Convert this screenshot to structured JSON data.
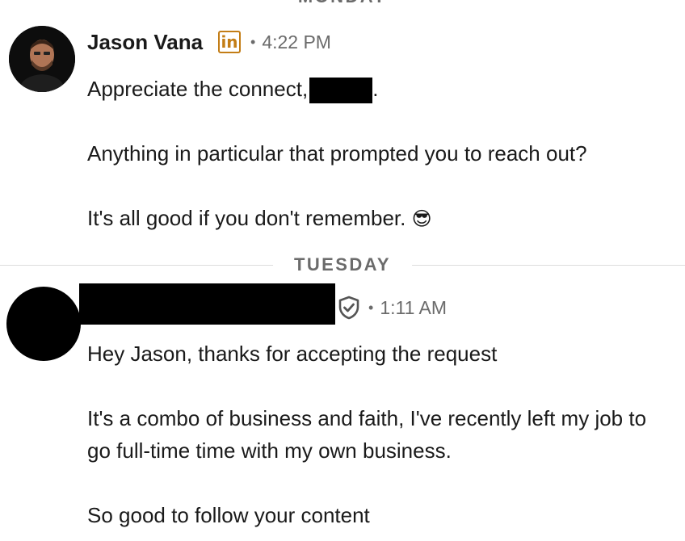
{
  "dividers": {
    "top": "MONDAY",
    "middle": "TUESDAY"
  },
  "messages": [
    {
      "sender": "Jason Vana",
      "badge": "in",
      "time": "4:22 PM",
      "lines": [
        "Appreciate the connect,",
        "Anything in particular that prompted you to reach out?",
        "It's all good if you don't remember."
      ],
      "suffix": ".",
      "emoji": "😎"
    },
    {
      "time": "1:11 AM",
      "lines": [
        "Hey Jason, thanks for accepting the request",
        "It's a combo of business and faith, I've recently left my job to go full-time time with my own business.",
        "So good to follow your content"
      ]
    }
  ],
  "icons": {
    "linkedin_badge": "linkedin-icon",
    "verified": "shield-check-icon"
  },
  "colors": {
    "badge": "#c37d16",
    "meta_text": "#6b6b6b",
    "divider_line": "#dcdcdc"
  }
}
